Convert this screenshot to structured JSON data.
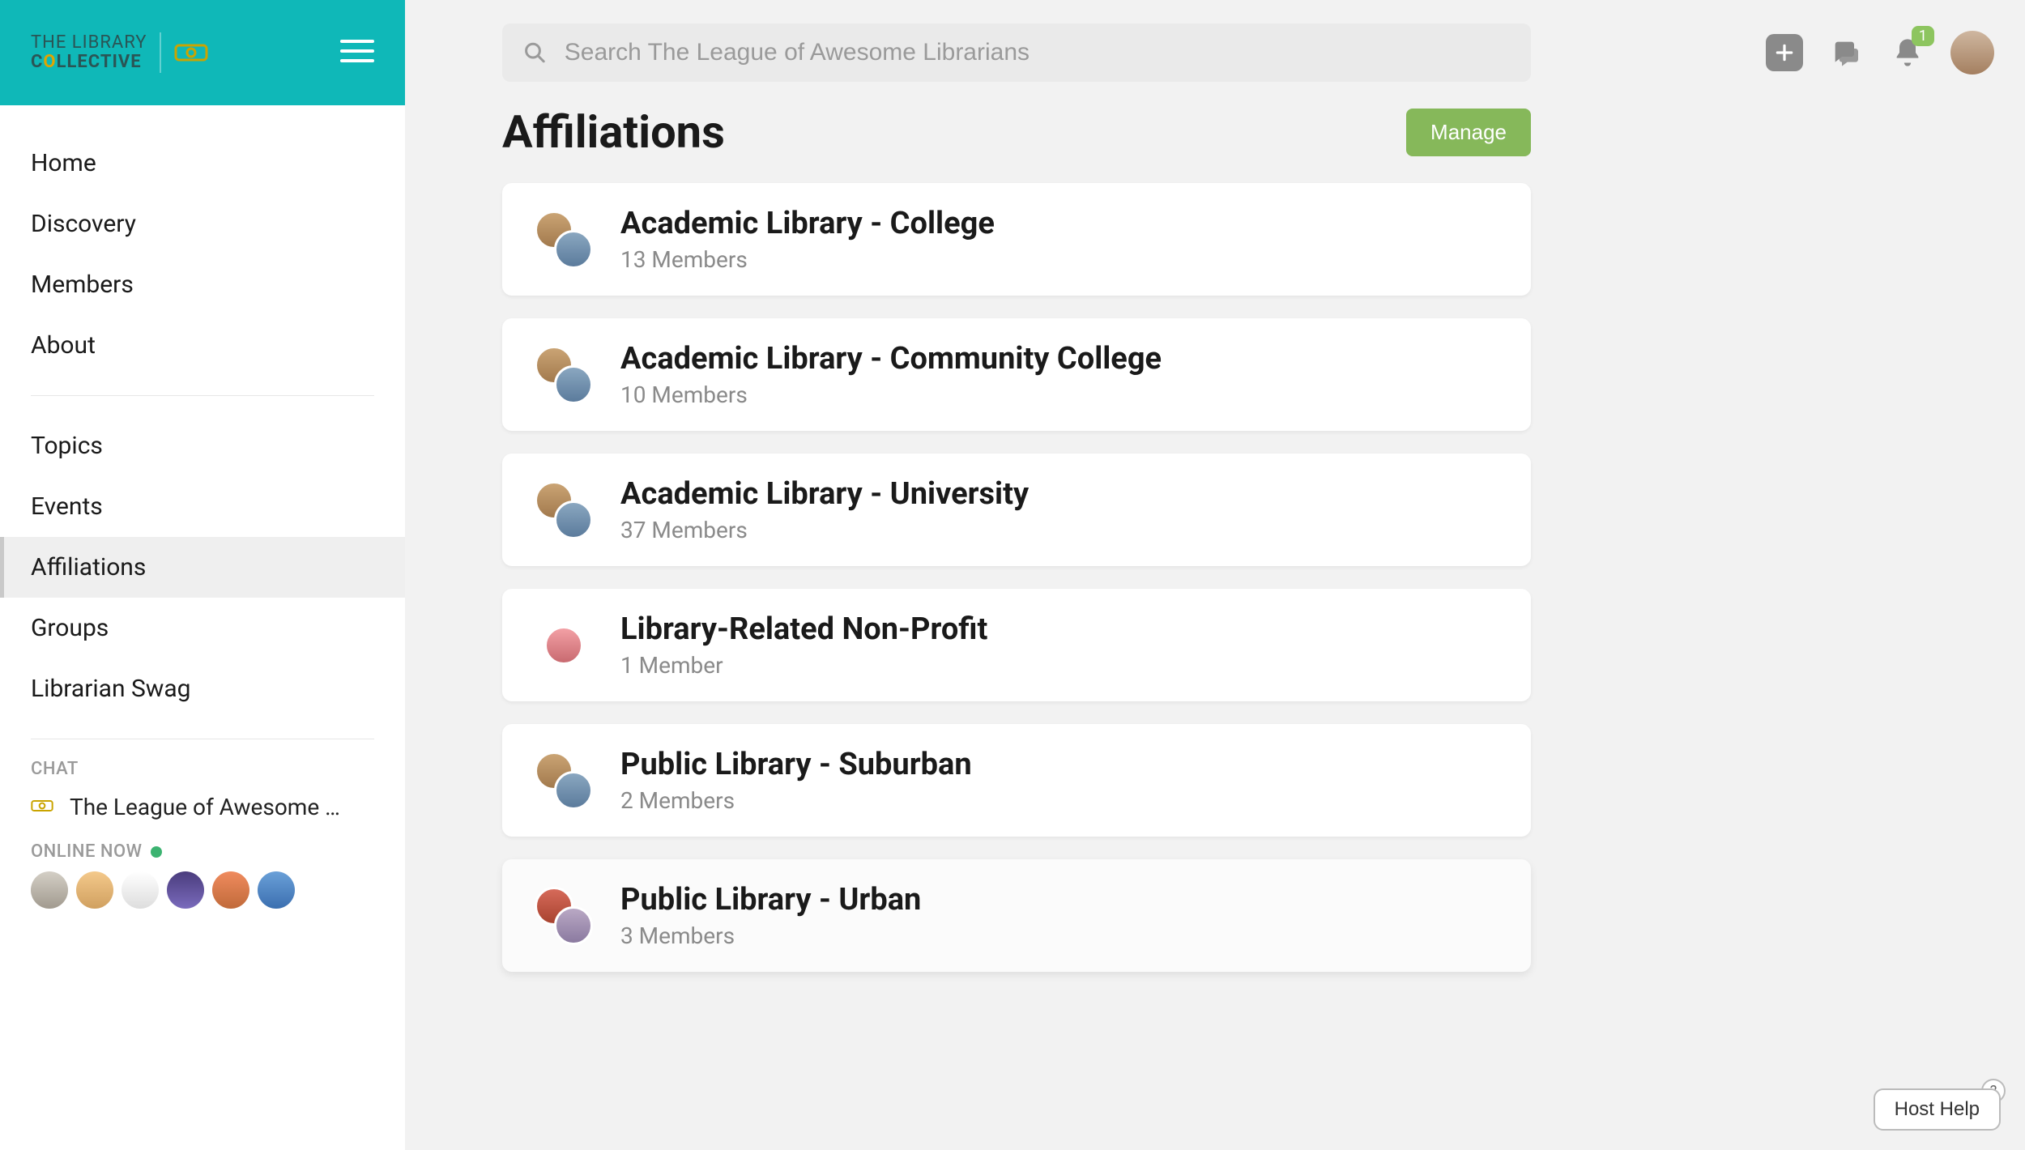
{
  "brand": {
    "top": "THE LIBRARY",
    "bottom": "COLLECTIVE"
  },
  "search": {
    "placeholder": "Search The League of Awesome Librarians"
  },
  "notifications": {
    "count": "1"
  },
  "nav": {
    "primary": [
      "Home",
      "Discovery",
      "Members",
      "About"
    ],
    "secondary": [
      "Topics",
      "Events",
      "Affiliations",
      "Groups",
      "Librarian Swag"
    ],
    "active_index": 2
  },
  "chat": {
    "heading": "CHAT",
    "channel": "The League of Awesome …"
  },
  "online": {
    "heading": "ONLINE NOW",
    "count": 6
  },
  "page": {
    "title": "Affiliations",
    "manage_label": "Manage"
  },
  "affiliations": [
    {
      "name": "Academic Library - College",
      "members": "13 Members"
    },
    {
      "name": "Academic Library - Community College",
      "members": "10 Members"
    },
    {
      "name": "Academic Library - University",
      "members": "37 Members"
    },
    {
      "name": "Library-Related Non-Profit",
      "members": "1 Member"
    },
    {
      "name": "Public Library - Suburban",
      "members": "2 Members"
    },
    {
      "name": "Public Library - Urban",
      "members": "3 Members"
    }
  ],
  "host_help": {
    "label": "Host Help"
  }
}
